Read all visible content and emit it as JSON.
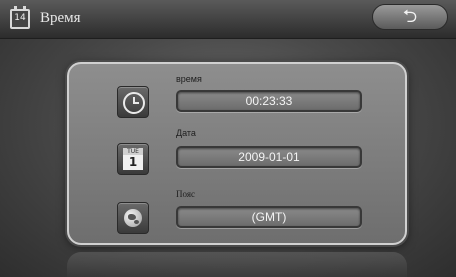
{
  "header": {
    "title": "Время",
    "title_icon_text": "14",
    "title_icon": "calendar-icon",
    "back_glyph": "⮌",
    "back_icon": "back-arrow-icon"
  },
  "settings": {
    "rows": [
      {
        "label": "время",
        "value": "00:23:33",
        "icon": "clock-icon"
      },
      {
        "label": "Дата",
        "value": "2009-01-01",
        "icon": "calendar-icon",
        "icon_day": "TUE",
        "icon_num": "1"
      },
      {
        "label": "Пояс",
        "value": "(GMT)",
        "icon": "globe-icon"
      }
    ]
  }
}
